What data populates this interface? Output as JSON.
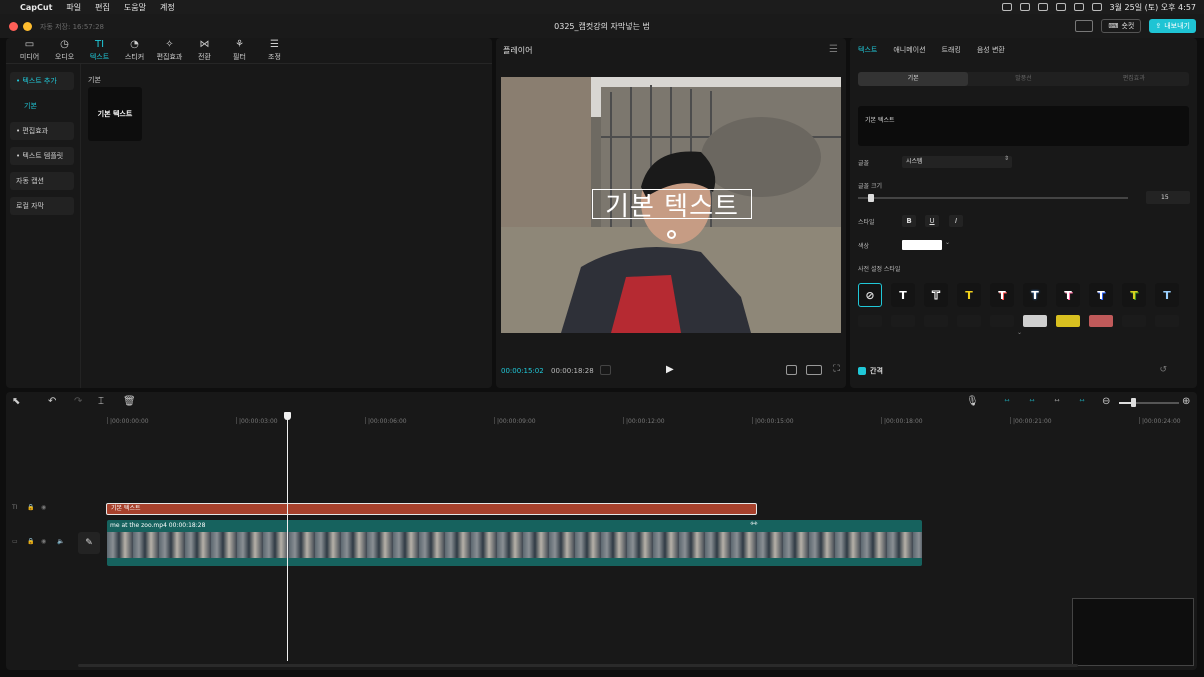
{
  "menubar": {
    "app_name": "CapCut",
    "items": [
      "파일",
      "편집",
      "도움말",
      "계정"
    ],
    "clock": "3월 25일 (토) 오후 4:57"
  },
  "titlebar": {
    "autosave": "자동 저장: 16:57:28",
    "title": "0325_캡컷강의 자막넣는 법",
    "shortcut_label": "숏컷",
    "export_label": "내보내기"
  },
  "media_tabs": [
    {
      "label": "미디어",
      "icon": "▭"
    },
    {
      "label": "오디오",
      "icon": "◷"
    },
    {
      "label": "텍스트",
      "icon": "TI"
    },
    {
      "label": "스티커",
      "icon": "◔"
    },
    {
      "label": "편집효과",
      "icon": "✧"
    },
    {
      "label": "전환",
      "icon": "⋈"
    },
    {
      "label": "필터",
      "icon": "⚘"
    },
    {
      "label": "조정",
      "icon": "☰"
    }
  ],
  "side_menu": [
    {
      "label": "• 텍스트 추가"
    },
    {
      "label": "기본"
    },
    {
      "label": "• 편집효과"
    },
    {
      "label": "• 텍스트 템플릿"
    },
    {
      "label": "자동 캡션"
    },
    {
      "label": "로컬 자막"
    }
  ],
  "text_library": {
    "section_title": "기본",
    "card_label": "기본 텍스트"
  },
  "player": {
    "title": "플레이어",
    "overlay_text": "기본 텍스트",
    "current_time": "00:00:15:02",
    "total_time": "00:00:18:28"
  },
  "props": {
    "tabs": [
      "텍스트",
      "애니메이션",
      "트래킹",
      "음성 변환"
    ],
    "sub_tabs": [
      "기본",
      "말풍선",
      "편집효과"
    ],
    "text_value": "기본 텍스트",
    "font_label": "글꼴",
    "font_value": "시스템",
    "size_label": "글꼴 크기",
    "size_value": "15",
    "style_label": "스타일",
    "style_buttons": [
      "B",
      "U",
      "I"
    ],
    "color_label": "색상",
    "color_value": "#ffffff",
    "preset_label": "사전 설정 스타일",
    "stroke_label": "간격"
  },
  "presets": [
    {
      "glyph": "⊘",
      "color": "#e0e0e0"
    },
    {
      "glyph": "T",
      "color": "#ffffff"
    },
    {
      "glyph": "T",
      "color": "#111111"
    },
    {
      "glyph": "T",
      "color": "#f2d21c"
    },
    {
      "glyph": "T",
      "color": "#ff4a4a"
    },
    {
      "glyph": "T",
      "color": "#ffffff"
    },
    {
      "glyph": "T",
      "color": "#ff6aa0"
    },
    {
      "glyph": "T",
      "color": "#ffffff"
    },
    {
      "glyph": "T",
      "color": "#d8d020"
    },
    {
      "glyph": "T",
      "color": "#9ad0ff"
    }
  ],
  "timeline": {
    "ticks": [
      "|00:00:00:00",
      "|00:00:03:00",
      "|00:00:06:00",
      "|00:00:09:00",
      "|00:00:12:00",
      "|00:00:15:00",
      "|00:00:18:00",
      "|00:00:21:00",
      "|00:00:24:00"
    ],
    "text_clip_label": "기본 텍스트",
    "video_clip_label": "me at the zoo.mp4  00:00:18:28"
  },
  "colors": {
    "accent": "#20c8d8",
    "text_clip": "#a7412c",
    "video_clip": "#16625e"
  }
}
